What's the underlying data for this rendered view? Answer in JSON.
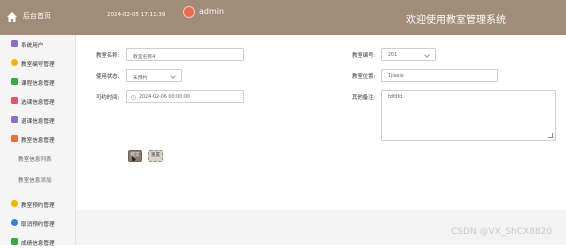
{
  "header": {
    "home_label": "后台首页",
    "datetime": "2024-02-05 17:11:39",
    "username": "admin",
    "system_title": "欢迎使用教室管理系统",
    "bg_color": "#a08c79"
  },
  "sidebar": {
    "items": [
      {
        "label": "系统用户",
        "icon": "users-icon",
        "color": "#8e6fc0"
      },
      {
        "label": "教室编号管理",
        "icon": "circle-icon",
        "color": "#f0b400"
      },
      {
        "label": "课程信息管理",
        "icon": "list-icon",
        "color": "#3da54a"
      },
      {
        "label": "选课信息管理",
        "icon": "book-icon",
        "color": "#e0566e"
      },
      {
        "label": "退课信息管理",
        "icon": "grid-icon",
        "color": "#8e6fc0"
      },
      {
        "label": "教室信息管理",
        "icon": "apps-icon",
        "color": "#e76f3a"
      },
      {
        "label": "教室预约管理",
        "icon": "circle-icon",
        "color": "#f0b400"
      },
      {
        "label": "取消预约管理",
        "icon": "star-icon",
        "color": "#3a7fd5"
      },
      {
        "label": "成绩信息管理",
        "icon": "list-icon",
        "color": "#3da54a"
      }
    ],
    "subitems": [
      {
        "label": "教室信息列表"
      },
      {
        "label": "教室信息添加"
      }
    ]
  },
  "form": {
    "name_label": "教室名称:",
    "name_value": "教室名称4",
    "number_label": "教室编号:",
    "number_value": "201",
    "status_label": "使用状态:",
    "status_value": "未预约",
    "location_label": "教室位置:",
    "location_value": "1jiaxie",
    "time_label": "可约时间:",
    "time_value": "2024-02-06 00:00:00",
    "remark_label": "其他备注:",
    "remark_value": "fdfdfd"
  },
  "buttons": {
    "submit": "提交",
    "reset": "重置"
  },
  "watermark": "CSDN @VX_ShCX8820"
}
